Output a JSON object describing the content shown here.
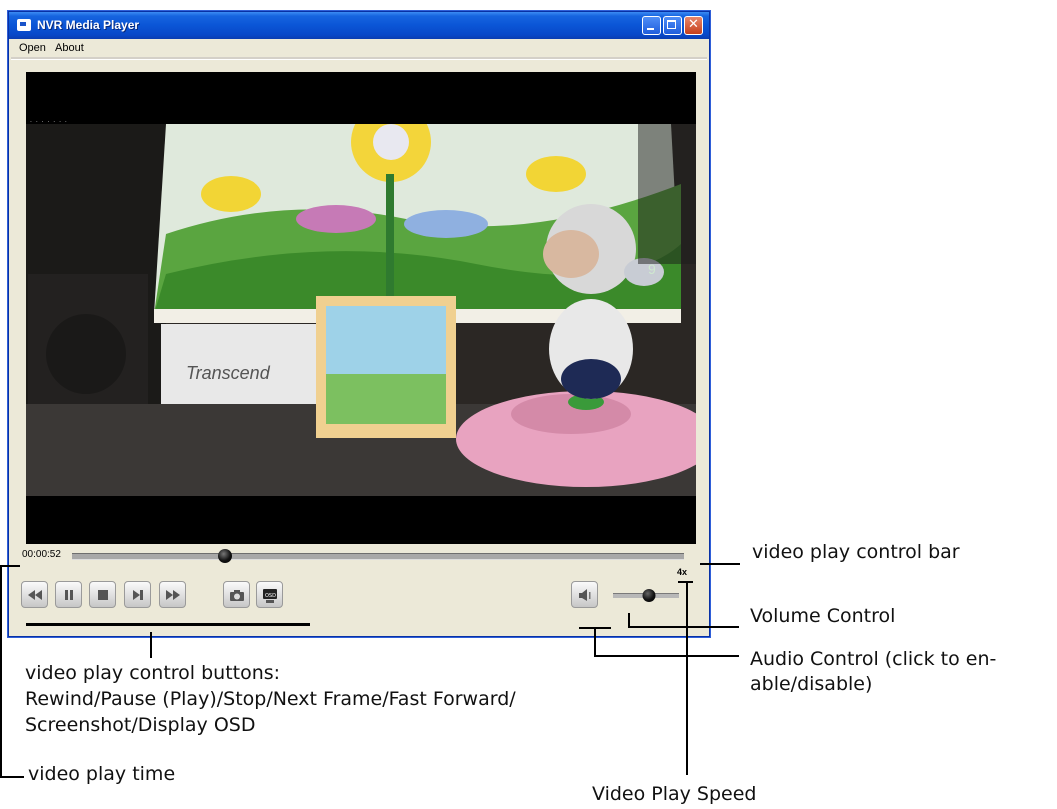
{
  "window": {
    "title": "NVR Media Player"
  },
  "menu": {
    "items": [
      "Open",
      "About"
    ]
  },
  "player": {
    "time": "00:00:52",
    "progress": 0.25,
    "volume": 0.55,
    "speed_label": "4x",
    "buttons": [
      "rewind",
      "pause",
      "stop",
      "next-frame",
      "fast-forward",
      "screenshot",
      "display-osd",
      "audio"
    ]
  },
  "annotations": {
    "control_bar": "video play control bar",
    "volume": "Volume Control",
    "audio_line1": "Audio Control (click to en-",
    "audio_line2": "able/disable)",
    "buttons_line1": "video play control buttons:",
    "buttons_line2": "Rewind/Pause (Play)/Stop/Next Frame/Fast Forward/",
    "buttons_line3": "Screenshot/Display OSD",
    "time": "video play time",
    "speed": "Video Play Speed"
  },
  "colors": {
    "titlebar": "#0a55d6",
    "window_bg": "#ece9d8",
    "video_bg": "#000000"
  }
}
